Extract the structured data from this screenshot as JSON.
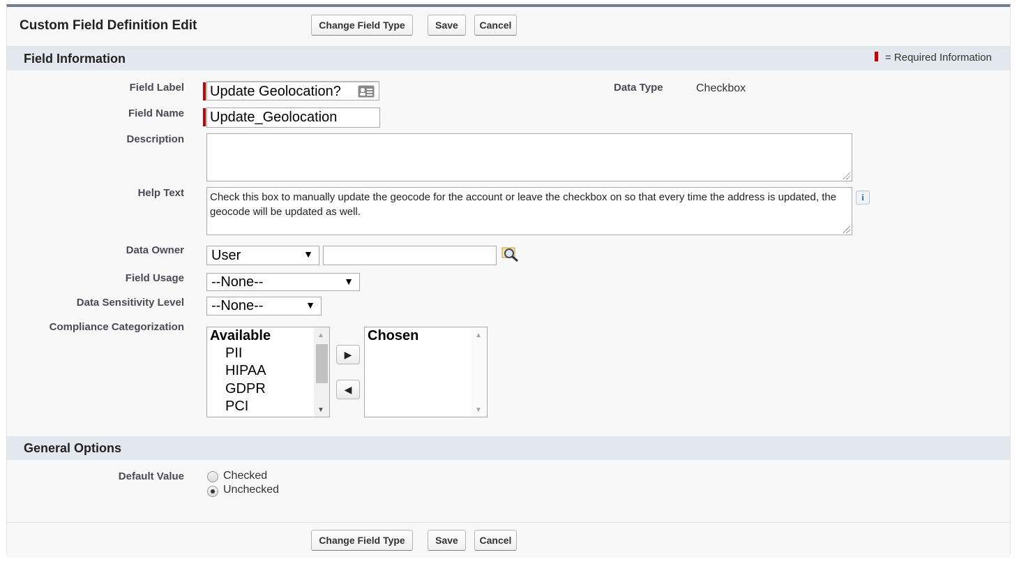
{
  "header": {
    "title": "Custom Field Definition Edit",
    "change_field_type_label": "Change Field Type",
    "save_label": "Save",
    "cancel_label": "Cancel"
  },
  "field_information": {
    "title": "Field Information",
    "required_legend": "= Required Information",
    "field_label_label": "Field Label",
    "field_label_value": "Update Geolocation?",
    "data_type_label": "Data Type",
    "data_type_value": "Checkbox",
    "field_name_label": "Field Name",
    "field_name_value": "Update_Geolocation",
    "description_label": "Description",
    "description_value": "",
    "help_text_label": "Help Text",
    "help_text_value": "Check this box to manually update the geocode for the account or leave the checkbox on so that every time the address is updated, the geocode will be updated as well.",
    "data_owner_label": "Data Owner",
    "data_owner_type": "User",
    "data_owner_value": "",
    "field_usage_label": "Field Usage",
    "field_usage_value": "--None--",
    "data_sensitivity_label": "Data Sensitivity Level",
    "data_sensitivity_value": "--None--",
    "compliance_label": "Compliance Categorization",
    "available_header": "Available",
    "available_options": [
      "PII",
      "HIPAA",
      "GDPR",
      "PCI"
    ],
    "chosen_header": "Chosen"
  },
  "general_options": {
    "title": "General Options",
    "default_value_label": "Default Value",
    "options": [
      "Checked",
      "Unchecked"
    ],
    "selected": "Unchecked"
  },
  "footer": {
    "change_field_type_label": "Change Field Type",
    "save_label": "Save",
    "cancel_label": "Cancel"
  },
  "colors": {
    "required": "#c00000",
    "section_header_bg": "#e3e8ee",
    "top_border": "#747e8b"
  },
  "icons": {
    "field_label_picker": "contact-card-icon",
    "lookup": "magnifier-lookup-icon",
    "help": "info-icon",
    "add": "right-arrow-icon",
    "remove": "left-arrow-icon"
  }
}
